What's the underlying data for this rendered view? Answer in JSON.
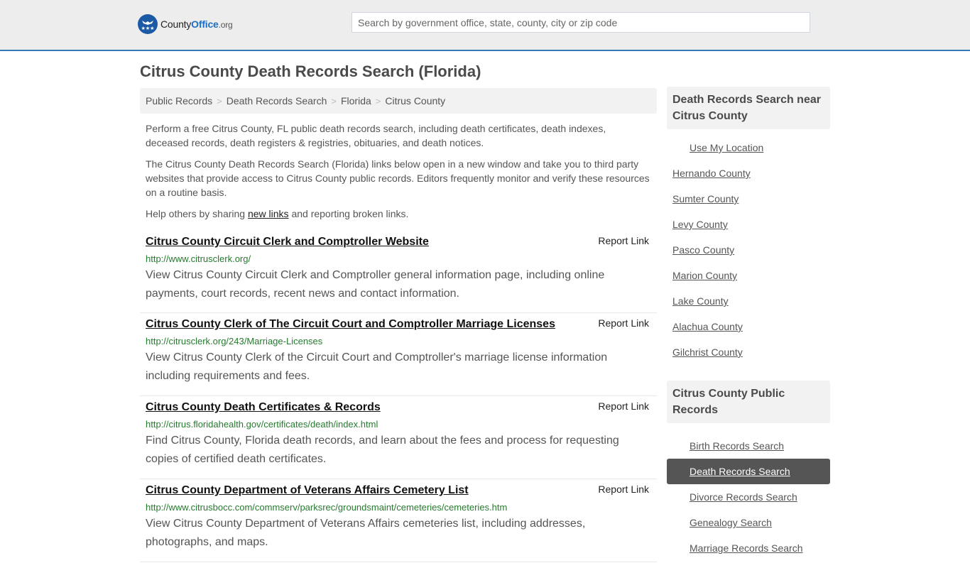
{
  "header": {
    "logo": {
      "name_prefix": "County",
      "name_highlight": "Office",
      "name_suffix": ".org"
    },
    "search": {
      "placeholder": "Search by government office, state, county, city or zip code",
      "value": ""
    }
  },
  "page_title": "Citrus County Death Records Search (Florida)",
  "breadcrumb": [
    {
      "label": "Public Records"
    },
    {
      "label": "Death Records Search"
    },
    {
      "label": "Florida"
    },
    {
      "label": "Citrus County"
    }
  ],
  "breadcrumb_separator": ">",
  "intro": {
    "p1": "Perform a free Citrus County, FL public death records search, including death certificates, death indexes, deceased records, death registers & registries, obituaries, and death notices.",
    "p2": "The Citrus County Death Records Search (Florida) links below open in a new window and take you to third party websites that provide access to Citrus County public records. Editors frequently monitor and verify these resources on a routine basis.",
    "p3_before": "Help others by sharing ",
    "p3_link": "new links",
    "p3_after": " and reporting broken links."
  },
  "results": [
    {
      "title": "Citrus County Circuit Clerk and Comptroller Website",
      "url": "http://www.citrusclerk.org/",
      "description": "View Citrus County Circuit Clerk and Comptroller general information page, including online payments, court records, recent news and contact information.",
      "report_label": "Report Link"
    },
    {
      "title": "Citrus County Clerk of The Circuit Court and Comptroller Marriage Licenses",
      "url": "http://citrusclerk.org/243/Marriage-Licenses",
      "description": "View Citrus County Clerk of the Circuit Court and Comptroller's marriage license information including requirements and fees.",
      "report_label": "Report Link"
    },
    {
      "title": "Citrus County Death Certificates & Records",
      "url": "http://citrus.floridahealth.gov/certificates/death/index.html",
      "description": "Find Citrus County, Florida death records, and learn about the fees and process for requesting copies of certified death certificates.",
      "report_label": "Report Link"
    },
    {
      "title": "Citrus County Department of Veterans Affairs Cemetery List",
      "url": "http://www.citrusbocc.com/commserv/parksrec/groundsmaint/cemeteries/cemeteries.htm",
      "description": "View Citrus County Department of Veterans Affairs cemeteries list, including addresses, photographs, and maps.",
      "report_label": "Report Link"
    }
  ],
  "sidebar": {
    "nearby": {
      "heading": "Death Records Search near Citrus County",
      "use_location": "Use My Location",
      "items": [
        "Hernando County",
        "Sumter County",
        "Levy County",
        "Pasco County",
        "Marion County",
        "Lake County",
        "Alachua County",
        "Gilchrist County"
      ]
    },
    "public_records": {
      "heading": "Citrus County Public Records",
      "items": [
        {
          "label": "Birth Records Search",
          "active": false
        },
        {
          "label": "Death Records Search",
          "active": true
        },
        {
          "label": "Divorce Records Search",
          "active": false
        },
        {
          "label": "Genealogy Search",
          "active": false
        },
        {
          "label": "Marriage Records Search",
          "active": false
        }
      ]
    }
  },
  "colors": {
    "header_bg": "#ededed",
    "header_border": "#337ab7",
    "logo_blue": "#1c5aa6",
    "url_green": "#267a2f",
    "active_item_bg": "#555555"
  }
}
